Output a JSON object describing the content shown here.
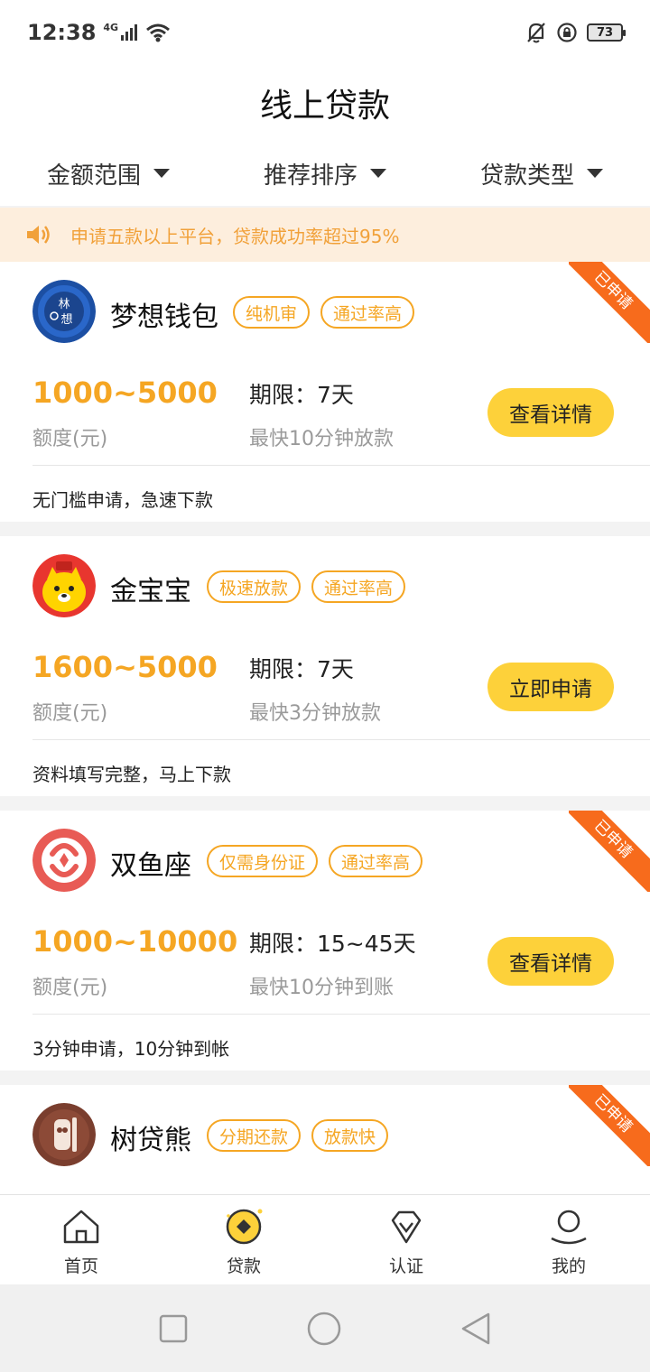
{
  "status": {
    "time": "12:38",
    "network": "4G",
    "battery": "73"
  },
  "header": {
    "title": "线上贷款"
  },
  "filters": [
    {
      "label": "金额范围"
    },
    {
      "label": "推荐排序"
    },
    {
      "label": "贷款类型"
    }
  ],
  "notice": {
    "text": "申请五款以上平台，贷款成功率超过95%"
  },
  "colors": {
    "accent": "#f5a623",
    "button": "#fdd13a",
    "ribbon": "#f76b1c",
    "notice_bg": "#fdeedd"
  },
  "loans": [
    {
      "name": "梦想钱包",
      "tags": [
        "纯机审",
        "通过率高"
      ],
      "amount": "1000~5000",
      "amount_label": "额度(元)",
      "term": "期限：7天",
      "speed": "最快10分钟放款",
      "button": "查看详情",
      "slogan": "无门槛申请，急速下款",
      "ribbon": "已申请",
      "logo_icon": "dream-wallet-logo-icon"
    },
    {
      "name": "金宝宝",
      "tags": [
        "极速放款",
        "通过率高"
      ],
      "amount": "1600~5000",
      "amount_label": "额度(元)",
      "term": "期限：7天",
      "speed": "最快3分钟放款",
      "button": "立即申请",
      "slogan": "资料填写完整，马上下款",
      "logo_icon": "jinbaobao-mascot-logo-icon"
    },
    {
      "name": "双鱼座",
      "tags": [
        "仅需身份证",
        "通过率高"
      ],
      "amount": "1000~10000",
      "amount_label": "额度(元)",
      "term": "期限：15~45天",
      "speed": "最快10分钟到账",
      "button": "查看详情",
      "slogan": "3分钟申请，10分钟到帐",
      "ribbon": "已申请",
      "logo_icon": "pisces-logo-icon"
    },
    {
      "name": "树贷熊",
      "tags": [
        "分期还款",
        "放款快"
      ],
      "ribbon": "已申请",
      "logo_icon": "tree-bear-logo-icon"
    }
  ],
  "bottom_nav": [
    {
      "label": "首页",
      "icon": "home-icon"
    },
    {
      "label": "贷款",
      "icon": "loan-coin-icon",
      "active": true
    },
    {
      "label": "认证",
      "icon": "verify-diamond-icon"
    },
    {
      "label": "我的",
      "icon": "profile-icon"
    }
  ]
}
